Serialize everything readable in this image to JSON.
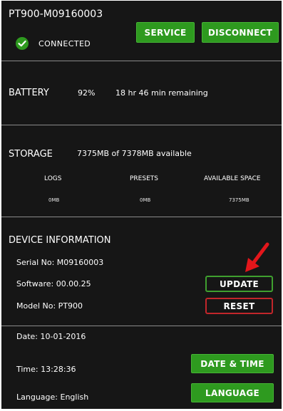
{
  "header": {
    "device_id": "PT900-M09160003",
    "status": "CONNECTED",
    "service_label": "SERVICE",
    "disconnect_label": "DISCONNECT"
  },
  "battery": {
    "label": "BATTERY",
    "percent": "92%",
    "remaining": "18 hr 46 min remaining"
  },
  "storage": {
    "label": "STORAGE",
    "summary": "7375MB of 7378MB available",
    "columns": [
      {
        "label": "LOGS",
        "value": "0MB"
      },
      {
        "label": "PRESETS",
        "value": "0MB"
      },
      {
        "label": "AVAILABLE SPACE",
        "value": "7375MB"
      }
    ]
  },
  "device_info": {
    "title": "DEVICE INFORMATION",
    "serial": "Serial No: M09160003",
    "software": "Software: 00.00.25",
    "model": "Model No: PT900",
    "update_label": "UPDATE",
    "reset_label": "RESET"
  },
  "datetime": {
    "date": "Date: 10-01-2016",
    "time": "Time: 13:28:36",
    "language": "Language: English",
    "date_time_label": "DATE & TIME",
    "language_label": "LANGUAGE"
  },
  "colors": {
    "background": "#161616",
    "button_green": "#2e9a1f",
    "update_outline": "#3fa02f",
    "reset_outline": "#c2262b",
    "arrow": "#e3161b"
  }
}
